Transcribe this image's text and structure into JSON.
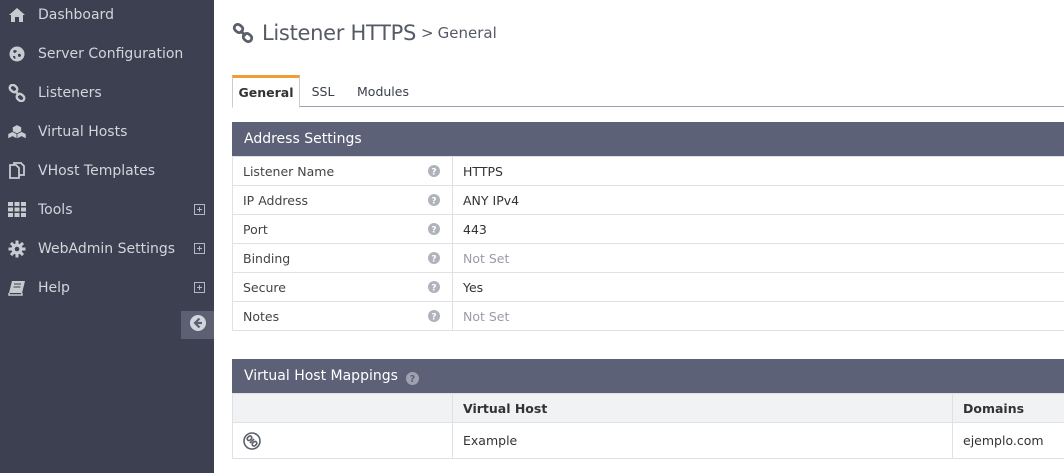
{
  "sidebar": {
    "items": [
      {
        "label": "Dashboard",
        "icon": "home-icon",
        "expandable": false
      },
      {
        "label": "Server Configuration",
        "icon": "globe-icon",
        "expandable": false
      },
      {
        "label": "Listeners",
        "icon": "link-icon",
        "expandable": false
      },
      {
        "label": "Virtual Hosts",
        "icon": "cubes-icon",
        "expandable": false
      },
      {
        "label": "VHost Templates",
        "icon": "copy-icon",
        "expandable": false
      },
      {
        "label": "Tools",
        "icon": "grid-icon",
        "expandable": true
      },
      {
        "label": "WebAdmin Settings",
        "icon": "gear-icon",
        "expandable": true
      },
      {
        "label": "Help",
        "icon": "book-icon",
        "expandable": true
      }
    ]
  },
  "page": {
    "title": "Listener HTTPS",
    "separator": ">",
    "subtitle": "General"
  },
  "tabs": [
    {
      "label": "General",
      "active": true
    },
    {
      "label": "SSL",
      "active": false
    },
    {
      "label": "Modules",
      "active": false
    }
  ],
  "address_settings": {
    "title": "Address Settings",
    "rows": [
      {
        "label": "Listener Name",
        "value": "HTTPS",
        "not_set": false
      },
      {
        "label": "IP Address",
        "value": "ANY IPv4",
        "not_set": false
      },
      {
        "label": "Port",
        "value": "443",
        "not_set": false
      },
      {
        "label": "Binding",
        "value": "Not Set",
        "not_set": true
      },
      {
        "label": "Secure",
        "value": "Yes",
        "not_set": false
      },
      {
        "label": "Notes",
        "value": "Not Set",
        "not_set": true
      }
    ]
  },
  "vhost_mappings": {
    "title": "Virtual Host Mappings",
    "columns": [
      "",
      "Virtual Host",
      "Domains"
    ],
    "rows": [
      {
        "virtual_host": "Example",
        "domains": "ejemplo.com"
      }
    ]
  },
  "colors": {
    "sidebar_bg": "#3d4050",
    "panel_header": "#5d6177",
    "tab_accent": "#f39c32"
  }
}
